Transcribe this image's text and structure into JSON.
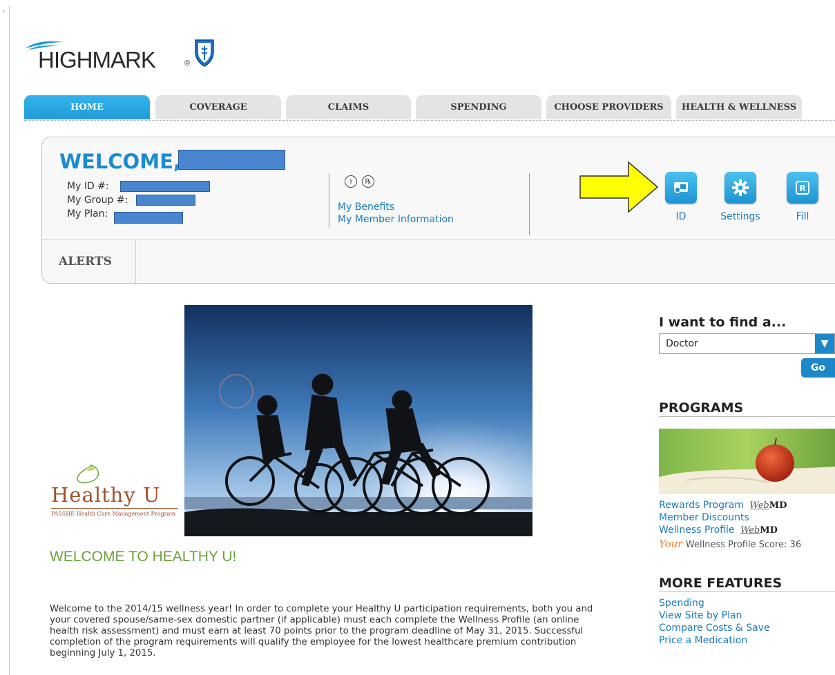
{
  "brand": {
    "name": "HIGHMARK",
    "reg": "®"
  },
  "tabs": [
    {
      "label": "HOME",
      "active": true
    },
    {
      "label": "COVERAGE",
      "active": false
    },
    {
      "label": "CLAIMS",
      "active": false
    },
    {
      "label": "SPENDING",
      "active": false
    },
    {
      "label": "CHOOSE PROVIDERS",
      "active": false
    },
    {
      "label": "HEALTH & WELLNESS",
      "active": false
    }
  ],
  "welcome": {
    "greeting": "WELCOME,",
    "id_label": "My ID #:",
    "group_label": "My Group #:",
    "plan_label": "My Plan:",
    "links": [
      "My Benefits",
      "My Member Information"
    ],
    "quick_actions": [
      {
        "label": "ID",
        "icon": "id-card-icon"
      },
      {
        "label": "Settings",
        "icon": "gear-icon"
      },
      {
        "label": "Fill",
        "icon": "rx-icon"
      }
    ],
    "alerts_label": "ALERTS"
  },
  "healthy_u": {
    "logo_text": "Healthy U",
    "logo_sub": "PASSHE Health Care Management Program",
    "title": "WELCOME TO HEALTHY U!",
    "body": "Welcome to the 2014/15 wellness year! In order to complete your Healthy U participation requirements, both you and your covered spouse/same-sex domestic partner (if applicable) must each complete the Wellness Profile (an online health risk assessment) and must earn at least 70 points prior to the program deadline of May 31, 2015. Successful completion of the program requirements will qualify the employee for the lowest healthcare premium contribution beginning July 1, 2015."
  },
  "finder": {
    "title": "I want to find a...",
    "selected": "Doctor",
    "go_label": "Go"
  },
  "programs": {
    "title": "PROGRAMS",
    "links": [
      "Rewards Program",
      "Member Discounts",
      "Wellness Profile"
    ],
    "webmd_label": "WebMD",
    "your_label": "Your",
    "score_text": "Wellness Profile Score: 36"
  },
  "more_features": {
    "title": "MORE FEATURES",
    "links": [
      "Spending",
      "View Site by Plan",
      "Compare Costs & Save",
      "Price a Medication"
    ]
  },
  "colors": {
    "accent": "#1a8bd1",
    "tab_active": "#2aa9e6",
    "healthy_green": "#6aa13b",
    "arrow_yellow": "#ffff00"
  }
}
